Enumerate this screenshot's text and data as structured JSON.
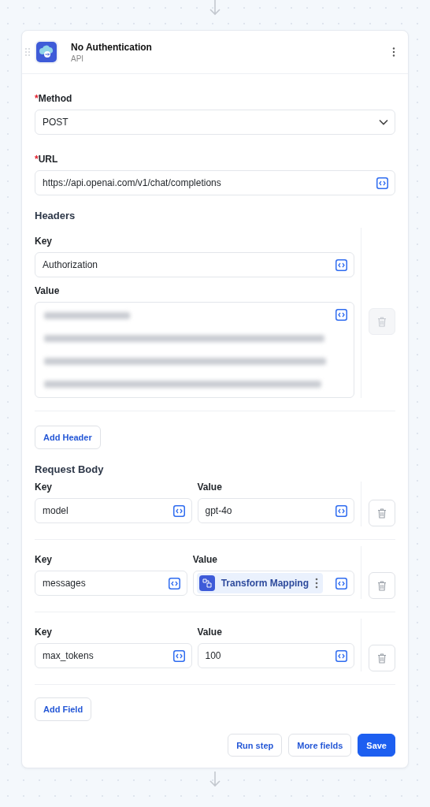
{
  "node": {
    "title": "No Authentication",
    "subtitle": "API"
  },
  "method": {
    "required_mark": "*",
    "label": "Method",
    "value": "POST"
  },
  "url": {
    "required_mark": "*",
    "label": "URL",
    "value": "https://api.openai.com/v1/chat/completions"
  },
  "headers": {
    "title": "Headers",
    "items": [
      {
        "key_label": "Key",
        "key": "Authorization",
        "value_label": "Value",
        "kind": "redacted",
        "delete_disabled": true
      }
    ]
  },
  "add_header": "Add Header",
  "request_body": {
    "title": "Request Body",
    "fields": [
      {
        "key_label": "Key",
        "key": "model",
        "value_label": "Value",
        "kind": "text",
        "value": "gpt-4o",
        "delete_disabled": false
      },
      {
        "key_label": "Key",
        "key": "messages",
        "value_label": "Value",
        "kind": "mapping",
        "value": "Transform Mapping",
        "delete_disabled": false
      },
      {
        "key_label": "Key",
        "key": "max_tokens",
        "value_label": "Value",
        "kind": "text",
        "value": "100",
        "delete_disabled": false
      }
    ]
  },
  "add_field": "Add Field",
  "actions": [
    {
      "label": "Run step",
      "primary": false
    },
    {
      "label": "More fields",
      "primary": false
    },
    {
      "label": "Save",
      "primary": true
    }
  ]
}
